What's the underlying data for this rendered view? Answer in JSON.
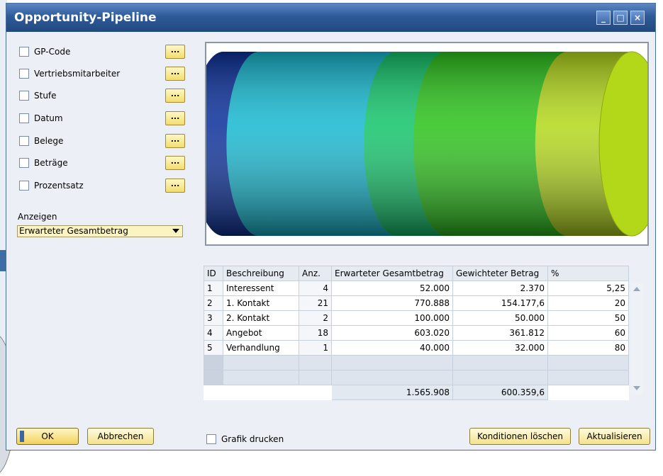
{
  "window": {
    "title": "Opportunity-Pipeline"
  },
  "titlebar_buttons": {
    "minimize": "_",
    "maximize": "□",
    "close": "×"
  },
  "filters": [
    {
      "label": "GP-Code"
    },
    {
      "label": "Vertriebsmitarbeiter"
    },
    {
      "label": "Stufe"
    },
    {
      "label": "Datum"
    },
    {
      "label": "Belege"
    },
    {
      "label": "Beträge"
    },
    {
      "label": "Prozentsatz"
    }
  ],
  "dots_label": "...",
  "display": {
    "label": "Anzeigen",
    "selected": "Erwarteter Gesamtbetrag"
  },
  "table": {
    "columns": [
      "ID",
      "Beschreibung",
      "Anz.",
      "Erwarteter Gesamtbetrag",
      "Gewichteter Betrag",
      "%"
    ],
    "rows": [
      [
        "1",
        "Interessent",
        "4",
        "52.000",
        "2.370",
        "5,25"
      ],
      [
        "2",
        "1. Kontakt",
        "21",
        "770.888",
        "154.177,6",
        "20"
      ],
      [
        "3",
        "2. Kontakt",
        "2",
        "100.000",
        "50.000",
        "50"
      ],
      [
        "4",
        "Angebot",
        "18",
        "603.020",
        "361.812",
        "60"
      ],
      [
        "5",
        "Verhandlung",
        "1",
        "40.000",
        "32.000",
        "80"
      ]
    ],
    "totals": {
      "expected": "1.565.908",
      "weighted": "600.359,6"
    }
  },
  "chart_data": {
    "type": "funnel",
    "categories": [
      "Interessent",
      "1. Kontakt",
      "2. Kontakt",
      "Angebot",
      "Verhandlung"
    ],
    "values": [
      52000,
      770888,
      100000,
      603020,
      40000
    ],
    "colors": [
      "#0a2f9a",
      "#16b8d0",
      "#12c46a",
      "#2bc21a",
      "#b3d81a"
    ]
  },
  "buttons": {
    "ok": "OK",
    "cancel": "Abbrechen",
    "print_graph": "Grafik drucken",
    "clear_conditions": "Konditionen löschen",
    "refresh": "Aktualisieren"
  }
}
